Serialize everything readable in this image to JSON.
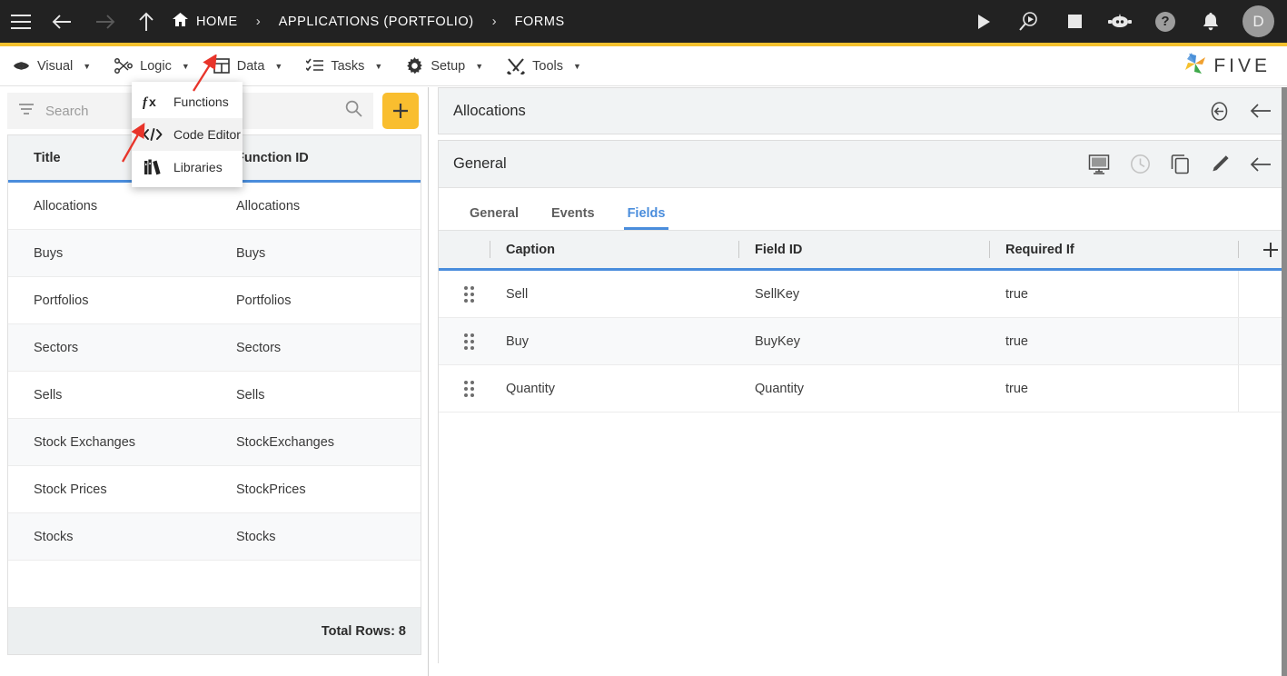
{
  "topbar": {
    "menu_icon": "hamburger-icon",
    "back_icon": "arrow-left-icon",
    "forward_icon": "arrow-right-icon",
    "up_icon": "arrow-up-icon",
    "breadcrumb": [
      {
        "label": "HOME",
        "icon": "home-icon"
      },
      {
        "label": "APPLICATIONS (PORTFOLIO)",
        "icon": ""
      },
      {
        "label": "FORMS",
        "icon": ""
      }
    ],
    "separator": "›",
    "right_icons": [
      {
        "name": "run-play-icon",
        "label": "Run"
      },
      {
        "name": "debug-search-play-icon",
        "label": "Debug"
      },
      {
        "name": "stop-square-icon",
        "label": "Stop"
      },
      {
        "name": "chatbot-icon",
        "label": "Assistant"
      },
      {
        "name": "help-question-icon",
        "label": "Help"
      },
      {
        "name": "notification-bell-icon",
        "label": "Notifications"
      }
    ],
    "avatar_initial": "D"
  },
  "menubar": {
    "items": [
      {
        "label": "Visual",
        "icon": "eye-icon",
        "caret": "▼"
      },
      {
        "label": "Logic",
        "icon": "logic-nodes-icon",
        "caret": "▼"
      },
      {
        "label": "Data",
        "icon": "table-grid-icon",
        "caret": "▼"
      },
      {
        "label": "Tasks",
        "icon": "task-list-icon",
        "caret": "▼"
      },
      {
        "label": "Setup",
        "icon": "gear-icon",
        "caret": "▼"
      },
      {
        "label": "Tools",
        "icon": "tools-icon",
        "caret": "▼"
      }
    ],
    "logo_text": "FIVE"
  },
  "dropdown": {
    "open_for": "Logic",
    "items": [
      {
        "label": "Functions",
        "icon": "fx-icon",
        "active": false
      },
      {
        "label": "Code Editor",
        "icon": "code-brackets-icon",
        "active": true
      },
      {
        "label": "Libraries",
        "icon": "books-icon",
        "active": false
      }
    ]
  },
  "annotations": {
    "arrow_color": "#e8342a",
    "arrows": [
      {
        "name": "arrow-to-logic-menu",
        "target": "Logic"
      },
      {
        "name": "arrow-to-code-editor",
        "target": "Code Editor"
      }
    ]
  },
  "left_panel": {
    "search": {
      "placeholder": "Search",
      "value": "",
      "filter_icon": "filter-icon",
      "search_icon": "search-icon"
    },
    "add_button": {
      "label": "+",
      "name": "add-form-button",
      "color": "#f9be2f"
    },
    "table": {
      "columns": [
        "Title",
        "Function ID"
      ],
      "rows": [
        {
          "title": "Allocations",
          "function_id": "Allocations"
        },
        {
          "title": "Buys",
          "function_id": "Buys"
        },
        {
          "title": "Portfolios",
          "function_id": "Portfolios"
        },
        {
          "title": "Sectors",
          "function_id": "Sectors"
        },
        {
          "title": "Sells",
          "function_id": "Sells"
        },
        {
          "title": "Stock Exchanges",
          "function_id": "StockExchanges"
        },
        {
          "title": "Stock Prices",
          "function_id": "StockPrices"
        },
        {
          "title": "Stocks",
          "function_id": "Stocks"
        }
      ],
      "footer": "Total Rows: 8"
    }
  },
  "right_panel": {
    "record_title": "Allocations",
    "record_actions": [
      {
        "name": "revert-undo-icon",
        "label": "Revert"
      },
      {
        "name": "close-back-arrow-icon",
        "label": "Back"
      }
    ],
    "section_title": "General",
    "section_actions": [
      {
        "name": "preview-monitor-icon",
        "label": "Preview",
        "disabled": false
      },
      {
        "name": "history-clock-icon",
        "label": "History",
        "disabled": true
      },
      {
        "name": "duplicate-copy-icon",
        "label": "Duplicate",
        "disabled": false
      },
      {
        "name": "edit-pencil-icon",
        "label": "Edit",
        "disabled": false
      },
      {
        "name": "back-arrow-icon",
        "label": "Back",
        "disabled": false
      }
    ],
    "tabs": [
      {
        "label": "General",
        "active": false
      },
      {
        "label": "Events",
        "active": false
      },
      {
        "label": "Fields",
        "active": true
      }
    ],
    "fields_table": {
      "columns": [
        "Caption",
        "Field ID",
        "Required If"
      ],
      "add_label": "+",
      "rows": [
        {
          "caption": "Sell",
          "field_id": "SellKey",
          "required_if": "true",
          "drag": "drag-handle-icon"
        },
        {
          "caption": "Buy",
          "field_id": "BuyKey",
          "required_if": "true",
          "drag": "drag-handle-icon"
        },
        {
          "caption": "Quantity",
          "field_id": "Quantity",
          "required_if": "true",
          "drag": "drag-handle-icon"
        }
      ]
    }
  },
  "theme": {
    "header_bg": "#222222",
    "accent_yellow": "#f5c12e",
    "accent_blue": "#4a8ddc",
    "panel_gray": "#f1f3f4",
    "alt_row": "#f8f9fa"
  }
}
